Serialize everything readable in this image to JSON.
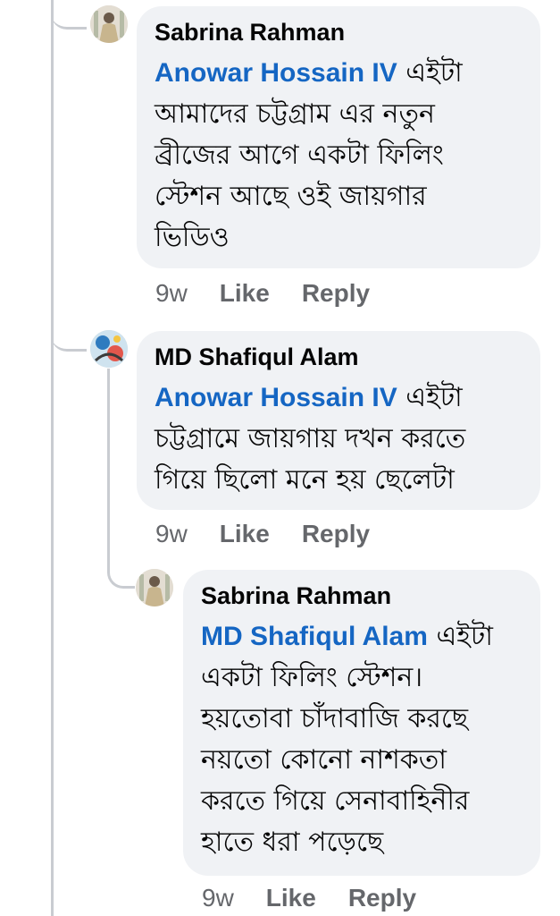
{
  "comments": [
    {
      "author": "Sabrina Rahman",
      "mention": "Anowar Hossain IV",
      "text": "এইটা আমাদের চট্টগ্রাম এর নতুন ব্রীজের আগে একটা ফিলিং স্টেশন আছে ওই জায়গার ভিডিও",
      "time": "9w",
      "like": "Like",
      "reply": "Reply"
    },
    {
      "author": "MD Shafiqul Alam",
      "mention": "Anowar Hossain IV",
      "text": "এইটা চট্টগ্রামে জায়গায় দখন করতে গিয়ে ছিলো মনে হয় ছেলেটা",
      "time": "9w",
      "like": "Like",
      "reply": "Reply"
    },
    {
      "author": "Sabrina Rahman",
      "mention": "MD Shafiqul Alam",
      "text": "এইটা একটা ফিলিং স্টেশন। হয়তোবা চাঁদাবাজি করছে নয়তো কোনো নাশকতা করতে গিয়ে সেনাবাহিনীর হাতে ধরা পড়েছে",
      "time": "9w",
      "like": "Like",
      "reply": "Reply"
    }
  ],
  "text_lines": {
    "c0": [
      "এইটা",
      "আমাদের চট্টগ্রাম এর নতুন",
      "ব্রীজের আগে একটা ফিলিং",
      "স্টেশন আছে ওই জায়গার",
      "ভিডিও"
    ],
    "c1": [
      "এইটা",
      "চট্টগ্রামে জায়গায় দখন করতে",
      "গিয়ে ছিলো মনে হয় ছেলেটা"
    ],
    "c2": [
      "এইটা",
      "একটা ফিলিং স্টেশন।",
      "হয়তোবা চাঁদাবাজি করছে",
      "নয়তো কোনো নাশকতা",
      "করতে গিয়ে সেনাবাহিনীর",
      "হাতে ধরা পড়েছে"
    ]
  },
  "colors": {
    "bubble": "#f0f2f5",
    "mention": "#1566c3",
    "meta": "#65676b",
    "thread": "#c9ccd1"
  },
  "icons": {
    "avatar_1": "user-avatar-icon",
    "avatar_2": "user-avatar-icon",
    "avatar_3": "user-avatar-icon"
  }
}
